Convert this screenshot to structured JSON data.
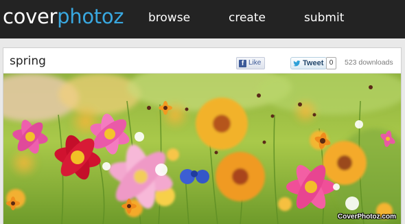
{
  "brand": {
    "part1": "cover",
    "part2": "photoz",
    "color_part1": "#ffffff",
    "color_part2": "#39a8e0"
  },
  "nav": {
    "browse": "browse",
    "create": "create",
    "submit": "submit"
  },
  "colors": {
    "topbar_bg": "#232323",
    "page_bg": "#e9e9e9"
  },
  "photo": {
    "title": "spring",
    "downloads": "523 downloads",
    "watermark": "CoverPhotoz.com",
    "subject": "wildflower-meadow"
  },
  "social": {
    "like_label": "Like",
    "like_icon": "facebook-f-icon",
    "tweet_label": "Tweet",
    "tweet_icon": "twitter-bird-icon",
    "tweet_count": "0"
  }
}
